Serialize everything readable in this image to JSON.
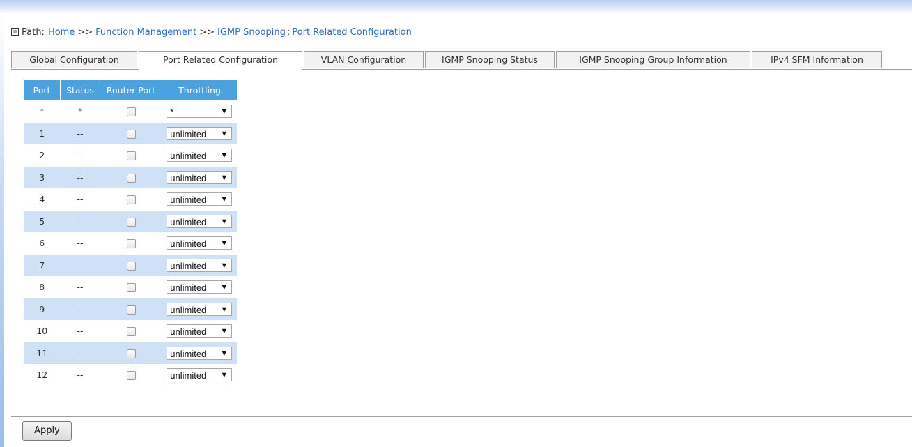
{
  "breadcrumb": {
    "label": "Path:",
    "items": [
      "Home",
      "Function Management",
      "IGMP Snooping"
    ],
    "separators": [
      ">>",
      ">>",
      ":"
    ],
    "current": "Port Related Configuration"
  },
  "tabs": [
    {
      "label": "Global Configuration",
      "active": false
    },
    {
      "label": "Port Related Configuration",
      "active": true
    },
    {
      "label": "VLAN Configuration",
      "active": false
    },
    {
      "label": "IGMP Snooping Status",
      "active": false
    },
    {
      "label": "IGMP Snooping Group Information",
      "active": false
    },
    {
      "label": "IPv4 SFM Information",
      "active": false
    }
  ],
  "table": {
    "headers": [
      "Port",
      "Status",
      "Router Port",
      "Throttling"
    ],
    "rows": [
      {
        "port": "*",
        "status": "*",
        "router_port": false,
        "throttling": "*"
      },
      {
        "port": "1",
        "status": "--",
        "router_port": false,
        "throttling": "unlimited"
      },
      {
        "port": "2",
        "status": "--",
        "router_port": false,
        "throttling": "unlimited"
      },
      {
        "port": "3",
        "status": "--",
        "router_port": false,
        "throttling": "unlimited"
      },
      {
        "port": "4",
        "status": "--",
        "router_port": false,
        "throttling": "unlimited"
      },
      {
        "port": "5",
        "status": "--",
        "router_port": false,
        "throttling": "unlimited"
      },
      {
        "port": "6",
        "status": "--",
        "router_port": false,
        "throttling": "unlimited"
      },
      {
        "port": "7",
        "status": "--",
        "router_port": false,
        "throttling": "unlimited"
      },
      {
        "port": "8",
        "status": "--",
        "router_port": false,
        "throttling": "unlimited"
      },
      {
        "port": "9",
        "status": "--",
        "router_port": false,
        "throttling": "unlimited"
      },
      {
        "port": "10",
        "status": "--",
        "router_port": false,
        "throttling": "unlimited"
      },
      {
        "port": "11",
        "status": "--",
        "router_port": false,
        "throttling": "unlimited"
      },
      {
        "port": "12",
        "status": "--",
        "router_port": false,
        "throttling": "unlimited"
      }
    ]
  },
  "apply_label": "Apply",
  "icons": {
    "dropdown": "triangle-down-icon",
    "path_marker": "square-icon"
  },
  "colors": {
    "header_bg": "#4aa3df",
    "stripe": "#cfe1f6",
    "link": "#2f6fb6"
  }
}
